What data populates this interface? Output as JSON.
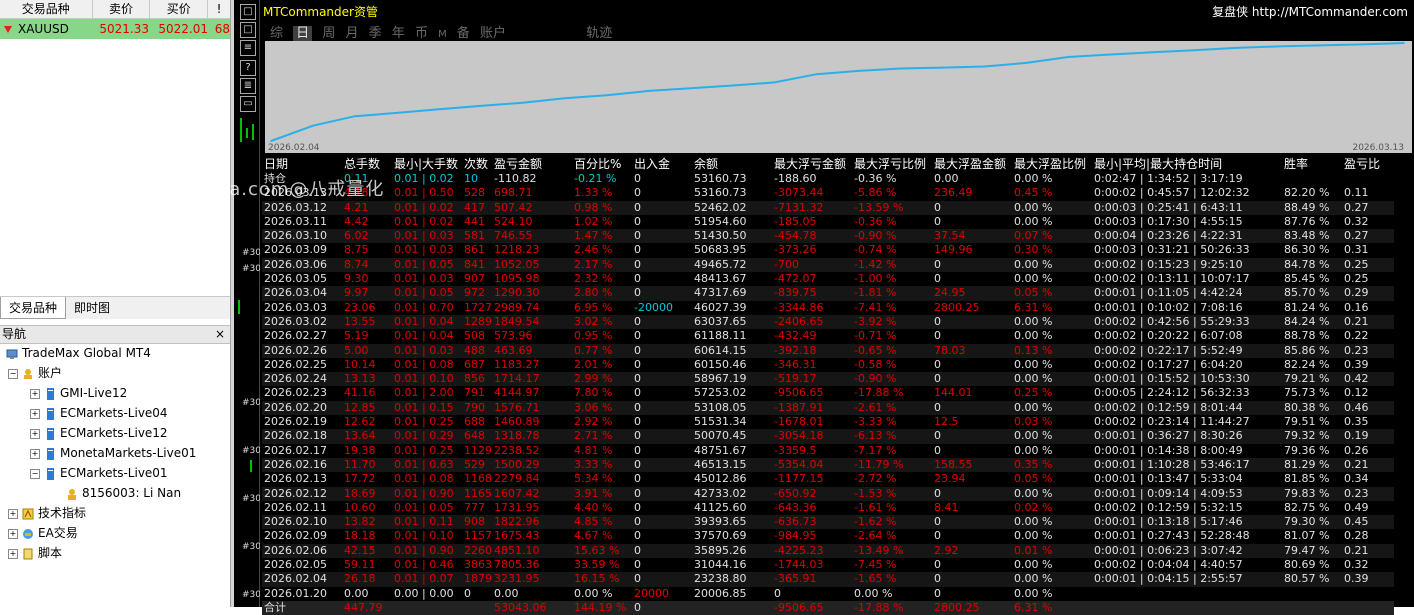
{
  "market_watch": {
    "headers": [
      "交易品种",
      "卖价",
      "买价",
      "!"
    ],
    "row": {
      "symbol": "XAUUSD",
      "bid": "5021.33",
      "ask": "5022.01",
      "spread": "68"
    }
  },
  "bottom_tabs": [
    "交易品种",
    "即时图"
  ],
  "navigator": {
    "title": "导航",
    "close": "×",
    "root": "TradeMax Global MT4",
    "accounts_label": "账户",
    "accounts": [
      "GMI-Live12",
      "ECMarkets-Live04",
      "ECMarkets-Live12",
      "MonetaMarkets-Live01",
      "ECMarkets-Live01"
    ],
    "account_user": "8156003: Li Nan",
    "others": [
      "技术指标",
      "EA交易",
      "脚本"
    ]
  },
  "strip_labels": [
    "#30",
    "#30",
    "#30",
    "#30",
    "#30",
    "#30",
    "#30"
  ],
  "panel": {
    "title": "MTCommander资管",
    "brand": "复盘侠 http://MTCommander.com",
    "tabs": [
      "综",
      "日",
      "周",
      "月",
      "季",
      "年",
      "币",
      "M",
      "备",
      "账户",
      "轨迹"
    ],
    "active_tab": "日",
    "chart_start": "2026.02.04",
    "chart_end": "2026.03.13",
    "headers": [
      "日期",
      "总手数",
      "最小|大手数",
      "次数",
      "盈亏金额",
      "百分比%",
      "出入金",
      "余额",
      "最大浮亏金额",
      "最大浮亏比例",
      "最大浮盈金额",
      "最大浮盈比例",
      "最小|平均|最大持仓时间",
      "胜率",
      "盈亏比"
    ],
    "holding_row": [
      "持仓",
      "0.11",
      "0.01 | 0.02",
      "10",
      "-110.82",
      "-0.21 %",
      "0",
      "53160.73",
      "-188.60",
      "-0.36 %",
      "0.00",
      "0.00 %",
      "0:02:47 | 1:34:52 | 3:17:19",
      "",
      ""
    ],
    "rows": [
      [
        "2026.03.13",
        "4.18",
        "0.01 | 0.50",
        "528",
        "698.71",
        "1.33 %",
        "0",
        "53160.73",
        "-3073.44",
        "-5.86 %",
        "236.49",
        "0.45 %",
        "0:00:02 | 0:45:57 | 12:02:32",
        "82.20 %",
        "0.11"
      ],
      [
        "2026.03.12",
        "4.21",
        "0.01 | 0.02",
        "417",
        "507.42",
        "0.98 %",
        "0",
        "52462.02",
        "-7131.32",
        "-13.59 %",
        "0",
        "0.00 %",
        "0:00:03 | 0:25:41 | 6:43:11",
        "88.49 %",
        "0.27"
      ],
      [
        "2026.03.11",
        "4.42",
        "0.01 | 0.02",
        "441",
        "524.10",
        "1.02 %",
        "0",
        "51954.60",
        "-185.05",
        "-0.36 %",
        "0",
        "0.00 %",
        "0:00:03 | 0:17:30 | 4:55:15",
        "87.76 %",
        "0.32"
      ],
      [
        "2026.03.10",
        "6.02",
        "0.01 | 0.03",
        "581",
        "746.55",
        "1.47 %",
        "0",
        "51430.50",
        "-454.78",
        "-0.90 %",
        "37.54",
        "0.07 %",
        "0:00:04 | 0:23:26 | 4:22:31",
        "83.48 %",
        "0.27"
      ],
      [
        "2026.03.09",
        "8.75",
        "0.01 | 0.03",
        "861",
        "1218.23",
        "2.46 %",
        "0",
        "50683.95",
        "-373.26",
        "-0.74 %",
        "149.96",
        "0.30 %",
        "0:00:03 | 0:31:21 | 50:26:33",
        "86.30 %",
        "0.31"
      ],
      [
        "2026.03.06",
        "8.74",
        "0.01 | 0.05",
        "841",
        "1052.05",
        "2.17 %",
        "0",
        "49465.72",
        "-700",
        "-1.42 %",
        "0",
        "0.00 %",
        "0:00:02 | 0:15:23 | 9:25:10",
        "84.78 %",
        "0.25"
      ],
      [
        "2026.03.05",
        "9.30",
        "0.01 | 0.03",
        "907",
        "1095.98",
        "2.32 %",
        "0",
        "48413.67",
        "-472.07",
        "-1.00 %",
        "0",
        "0.00 %",
        "0:00:02 | 0:13:11 | 10:07:17",
        "85.45 %",
        "0.25"
      ],
      [
        "2026.03.04",
        "9.97",
        "0.01 | 0.05",
        "972",
        "1290.30",
        "2.80 %",
        "0",
        "47317.69",
        "-839.75",
        "-1.81 %",
        "24.95",
        "0.05 %",
        "0:00:01 | 0:11:05 | 4:42:24",
        "85.70 %",
        "0.29"
      ],
      [
        "2026.03.03",
        "23.06",
        "0.01 | 0.70",
        "1727",
        "2989.74",
        "6.95 %",
        "-20000",
        "46027.39",
        "-3344.86",
        "-7.41 %",
        "2800.25",
        "6.31 %",
        "0:00:01 | 0:10:02 | 7:08:16",
        "81.24 %",
        "0.16"
      ],
      [
        "2026.03.02",
        "13.55",
        "0.01 | 0.04",
        "1289",
        "1849.54",
        "3.02 %",
        "0",
        "63037.65",
        "-2406.65",
        "-3.92 %",
        "0",
        "0.00 %",
        "0:00:02 | 0:42:56 | 55:29:33",
        "84.24 %",
        "0.21"
      ],
      [
        "2026.02.27",
        "5.19",
        "0.01 | 0.04",
        "508",
        "573.96",
        "0.95 %",
        "0",
        "61188.11",
        "-432.49",
        "-0.71 %",
        "0",
        "0.00 %",
        "0:00:02 | 0:20:22 | 6:07:08",
        "88.78 %",
        "0.22"
      ],
      [
        "2026.02.26",
        "5.00",
        "0.01 | 0.03",
        "488",
        "463.69",
        "0.77 %",
        "0",
        "60614.15",
        "-392.18",
        "-0.65 %",
        "78.03",
        "0.13 %",
        "0:00:02 | 0:22:17 | 5:52:49",
        "85.86 %",
        "0.23"
      ],
      [
        "2026.02.25",
        "10.14",
        "0.01 | 0.08",
        "687",
        "1183.27",
        "2.01 %",
        "0",
        "60150.46",
        "-346.31",
        "-0.58 %",
        "0",
        "0.00 %",
        "0:00:02 | 0:17:27 | 6:04:20",
        "82.24 %",
        "0.39"
      ],
      [
        "2026.02.24",
        "13.13",
        "0.01 | 0.10",
        "856",
        "1714.17",
        "2.99 %",
        "0",
        "58967.19",
        "-519.17",
        "-0.90 %",
        "0",
        "0.00 %",
        "0:00:01 | 0:15:52 | 10:53:30",
        "79.21 %",
        "0.42"
      ],
      [
        "2026.02.23",
        "41.16",
        "0.01 | 2.00",
        "791",
        "4144.97",
        "7.80 %",
        "0",
        "57253.02",
        "-9506.65",
        "-17.88 %",
        "144.01",
        "0.25 %",
        "0:00:05 | 2:24:12 | 56:32:33",
        "75.73 %",
        "0.12"
      ],
      [
        "2026.02.20",
        "12.85",
        "0.01 | 0.15",
        "790",
        "1576.71",
        "3.06 %",
        "0",
        "53108.05",
        "-1387.91",
        "-2.61 %",
        "0",
        "0.00 %",
        "0:00:02 | 0:12:59 | 8:01:44",
        "80.38 %",
        "0.46"
      ],
      [
        "2026.02.19",
        "12.62",
        "0.01 | 0.25",
        "688",
        "1460.89",
        "2.92 %",
        "0",
        "51531.34",
        "-1678.01",
        "-3.33 %",
        "12.5",
        "0.03 %",
        "0:00:02 | 0:23:14 | 11:44:27",
        "79.51 %",
        "0.35"
      ],
      [
        "2026.02.18",
        "13.64",
        "0.01 | 0.29",
        "648",
        "1318.78",
        "2.71 %",
        "0",
        "50070.45",
        "-3054.18",
        "-6.13 %",
        "0",
        "0.00 %",
        "0:00:01 | 0:36:27 | 8:30:26",
        "79.32 %",
        "0.19"
      ],
      [
        "2026.02.17",
        "19.38",
        "0.01 | 0.25",
        "1129",
        "2238.52",
        "4.81 %",
        "0",
        "48751.67",
        "-3359.5",
        "-7.17 %",
        "0",
        "0.00 %",
        "0:00:01 | 0:14:38 | 8:00:49",
        "79.36 %",
        "0.26"
      ],
      [
        "2026.02.16",
        "11.70",
        "0.01 | 0.63",
        "529",
        "1500.29",
        "3.33 %",
        "0",
        "46513.15",
        "-5354.04",
        "-11.79 %",
        "158.55",
        "0.35 %",
        "0:00:01 | 1:10:28 | 53:46:17",
        "81.29 %",
        "0.21"
      ],
      [
        "2026.02.13",
        "17.72",
        "0.01 | 0.08",
        "1168",
        "2279.84",
        "5.34 %",
        "0",
        "45012.86",
        "-1177.15",
        "-2.72 %",
        "23.94",
        "0.05 %",
        "0:00:01 | 0:13:47 | 5:33:04",
        "81.85 %",
        "0.34"
      ],
      [
        "2026.02.12",
        "18.69",
        "0.01 | 0.90",
        "1165",
        "1607.42",
        "3.91 %",
        "0",
        "42733.02",
        "-650.92",
        "-1.53 %",
        "0",
        "0.00 %",
        "0:00:01 | 0:09:14 | 4:09:53",
        "79.83 %",
        "0.23"
      ],
      [
        "2026.02.11",
        "10.60",
        "0.01 | 0.05",
        "777",
        "1731.95",
        "4.40 %",
        "0",
        "41125.60",
        "-643.36",
        "-1.61 %",
        "8.41",
        "0.02 %",
        "0:00:02 | 0:12:59 | 5:32:15",
        "82.75 %",
        "0.49"
      ],
      [
        "2026.02.10",
        "13.82",
        "0.01 | 0.11",
        "908",
        "1822.96",
        "4.85 %",
        "0",
        "39393.65",
        "-636.73",
        "-1.62 %",
        "0",
        "0.00 %",
        "0:00:01 | 0:13:18 | 5:17:46",
        "79.30 %",
        "0.45"
      ],
      [
        "2026.02.09",
        "18.18",
        "0.01 | 0.10",
        "1157",
        "1675.43",
        "4.67 %",
        "0",
        "37570.69",
        "-984.95",
        "-2.64 %",
        "0",
        "0.00 %",
        "0:00:01 | 0:27:43 | 52:28:48",
        "81.07 %",
        "0.28"
      ],
      [
        "2026.02.06",
        "42.15",
        "0.01 | 0.90",
        "2260",
        "4851.10",
        "15.63 %",
        "0",
        "35895.26",
        "-4225.23",
        "-13.49 %",
        "2.92",
        "0.01 %",
        "0:00:01 | 0:06:23 | 3:07:42",
        "79.47 %",
        "0.21"
      ],
      [
        "2026.02.05",
        "59.11",
        "0.01 | 0.46",
        "3863",
        "7805.36",
        "33.59 %",
        "0",
        "31044.16",
        "-1744.03",
        "-7.45 %",
        "0",
        "0.00 %",
        "0:00:02 | 0:04:04 | 4:40:57",
        "80.69 %",
        "0.32"
      ],
      [
        "2026.02.04",
        "26.18",
        "0.01 | 0.07",
        "1879",
        "3231.95",
        "16.15 %",
        "0",
        "23238.80",
        "-365.91",
        "-1.65 %",
        "0",
        "0.00 %",
        "0:00:01 | 0:04:15 | 2:55:57",
        "80.57 %",
        "0.39"
      ],
      [
        "2026.01.20",
        "0.00",
        "0.00 | 0.00",
        "0",
        "0.00",
        "0.00 %",
        "20000",
        "20006.85",
        "0",
        "0.00 %",
        "0",
        "0.00 %",
        "",
        "",
        ""
      ]
    ],
    "total_row": [
      "合计",
      "447.79",
      "",
      "",
      "53043.06",
      "144.19 %",
      "0",
      "",
      "-9506.65",
      "-17.88 %",
      "2800.25",
      "6.31 %",
      "",
      "",
      ""
    ]
  },
  "watermark": "www.eazhijia.com@八戒量化",
  "chart_data": {
    "type": "line",
    "x": [
      "2026.02.04",
      "2026.02.05",
      "2026.02.06",
      "2026.02.09",
      "2026.02.10",
      "2026.02.11",
      "2026.02.12",
      "2026.02.13",
      "2026.02.16",
      "2026.02.17",
      "2026.02.18",
      "2026.02.19",
      "2026.02.20",
      "2026.02.23",
      "2026.02.24",
      "2026.02.25",
      "2026.02.26",
      "2026.02.27",
      "2026.03.02",
      "2026.03.03",
      "2026.03.04",
      "2026.03.05",
      "2026.03.06",
      "2026.03.09",
      "2026.03.10",
      "2026.03.11",
      "2026.03.12",
      "2026.03.13"
    ],
    "values": [
      23238.8,
      31044.16,
      35895.26,
      37570.69,
      39393.65,
      41125.6,
      42733.02,
      45012.86,
      46513.15,
      48751.67,
      50070.45,
      51531.34,
      53108.05,
      57253.02,
      58967.19,
      60150.46,
      60614.15,
      61188.11,
      63037.65,
      66027.39,
      67317.69,
      68413.67,
      69465.72,
      70683.95,
      71430.5,
      71954.6,
      72462.02,
      73160.73
    ],
    "colors": {
      "line": "#2ab0e8",
      "bg": "#c8c8c8"
    }
  }
}
